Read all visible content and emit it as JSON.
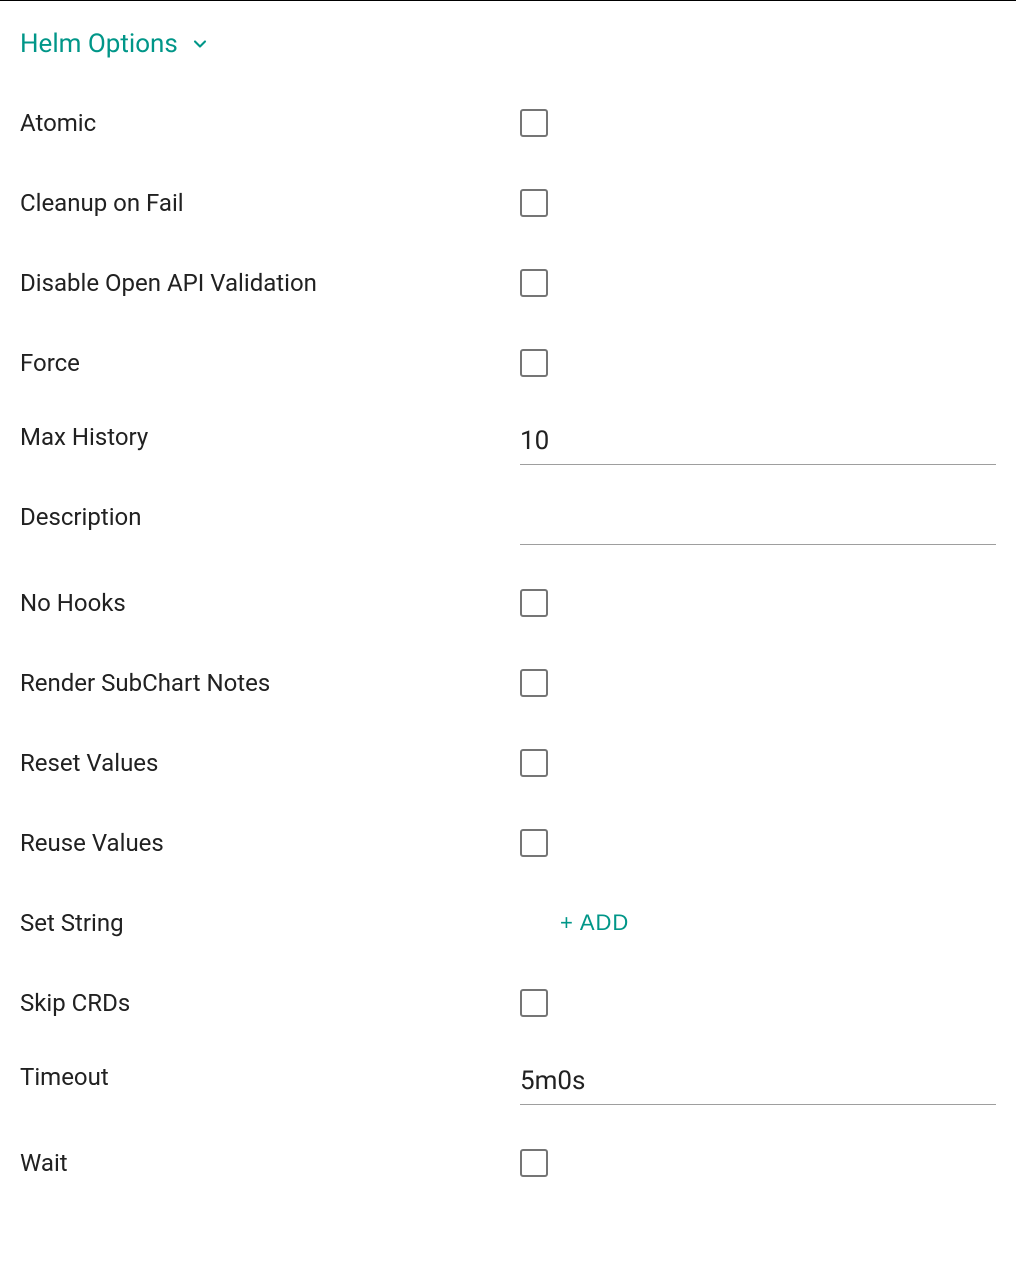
{
  "section": {
    "title": "Helm Options"
  },
  "fields": {
    "atomic": {
      "label": "Atomic",
      "checked": false
    },
    "cleanup_on_fail": {
      "label": "Cleanup on Fail",
      "checked": false
    },
    "disable_open_api_validation": {
      "label": "Disable Open API Validation",
      "checked": false
    },
    "force": {
      "label": "Force",
      "checked": false
    },
    "max_history": {
      "label": "Max History",
      "value": "10"
    },
    "description": {
      "label": "Description",
      "value": ""
    },
    "no_hooks": {
      "label": "No Hooks",
      "checked": false
    },
    "render_subchart_notes": {
      "label": "Render SubChart Notes",
      "checked": false
    },
    "reset_values": {
      "label": "Reset Values",
      "checked": false
    },
    "reuse_values": {
      "label": "Reuse Values",
      "checked": false
    },
    "set_string": {
      "label": "Set String",
      "add_label": "ADD"
    },
    "skip_crds": {
      "label": "Skip CRDs",
      "checked": false
    },
    "timeout": {
      "label": "Timeout",
      "value": "5m0s"
    },
    "wait": {
      "label": "Wait",
      "checked": false
    }
  },
  "colors": {
    "accent": "#009688"
  }
}
